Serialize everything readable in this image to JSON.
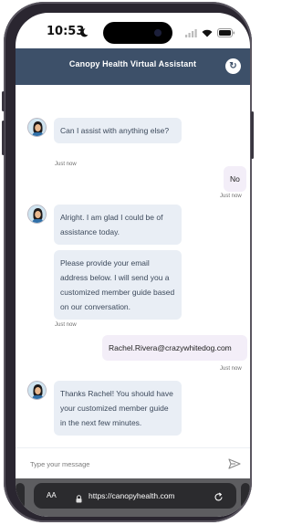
{
  "status_bar": {
    "time": "10:53"
  },
  "header": {
    "title": "Canopy Health Virtual Assistant",
    "refresh_icon": "↻"
  },
  "messages": [
    {
      "sender": "assistant",
      "text": "Can I assist with anything else?",
      "time": "Just now"
    },
    {
      "sender": "user",
      "text": "No",
      "time": "Just now"
    },
    {
      "sender": "assistant",
      "text": "Alright. I am glad I could be of assistance today."
    },
    {
      "sender": "assistant",
      "text": "Please provide your email address below. I will send you a customized member guide based on our conversation.",
      "time": "Just now"
    },
    {
      "sender": "user",
      "text": "Rachel.Rivera@crazywhitedog.com",
      "time": "Just now"
    },
    {
      "sender": "assistant",
      "text": "Thanks Rachel! You should have your customized member guide in the next few minutes."
    }
  ],
  "composer": {
    "placeholder": "Type your message"
  },
  "browser": {
    "aa_label": "AA",
    "url": "https://canopyhealth.com"
  },
  "colors": {
    "header": "#3d5069",
    "assistant_bubble": "#e9eef5",
    "user_bubble": "#f3eef8"
  }
}
